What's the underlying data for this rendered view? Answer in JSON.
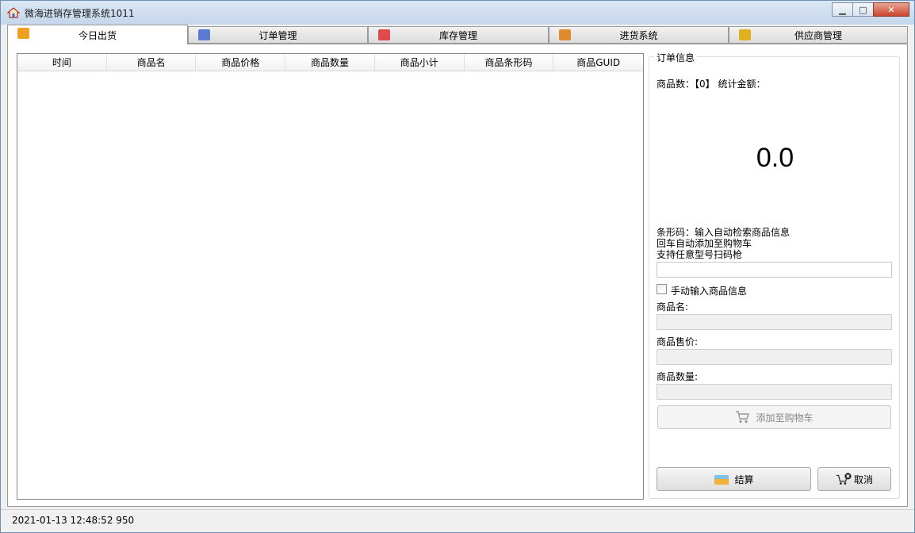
{
  "window": {
    "title": "微海进销存管理系统1011",
    "minimize": "▁",
    "maximize": "□",
    "close": "✕"
  },
  "tabs": [
    {
      "label": "今日出货",
      "icon": "fruit-basket-icon",
      "color": "#f0a020"
    },
    {
      "label": "订单管理",
      "icon": "order-list-icon",
      "color": "#5a7bd0"
    },
    {
      "label": "库存管理",
      "icon": "store-icon",
      "color": "#e04a4a"
    },
    {
      "label": "进货系统",
      "icon": "goods-icon",
      "color": "#e08a30"
    },
    {
      "label": "供应商管理",
      "icon": "supplier-icon",
      "color": "#e0b020"
    }
  ],
  "grid": {
    "columns": [
      "时间",
      "商品名",
      "商品价格",
      "商品数量",
      "商品小计",
      "商品条形码",
      "商品GUID"
    ],
    "rows": []
  },
  "order_info": {
    "group_title": "订单信息",
    "summary_label": "商品数：【0】 统计金额：",
    "total_amount": "0.0",
    "barcode_hint_1": "条形码：输入自动检索商品信息",
    "barcode_hint_2": "回车自动添加至购物车",
    "barcode_hint_3": "支持任意型号扫码枪",
    "barcode_value": "",
    "manual_checkbox_label": "手动输入商品信息",
    "manual_checked": false,
    "name_label": "商品名:",
    "name_value": "",
    "price_label": "商品售价:",
    "price_value": "",
    "qty_label": "商品数量:",
    "qty_value": "",
    "add_to_cart_label": "添加至购物车",
    "checkout_label": "结算",
    "cancel_label": "取消"
  },
  "status": {
    "timestamp": "2021-01-13 12:48:52 950"
  }
}
